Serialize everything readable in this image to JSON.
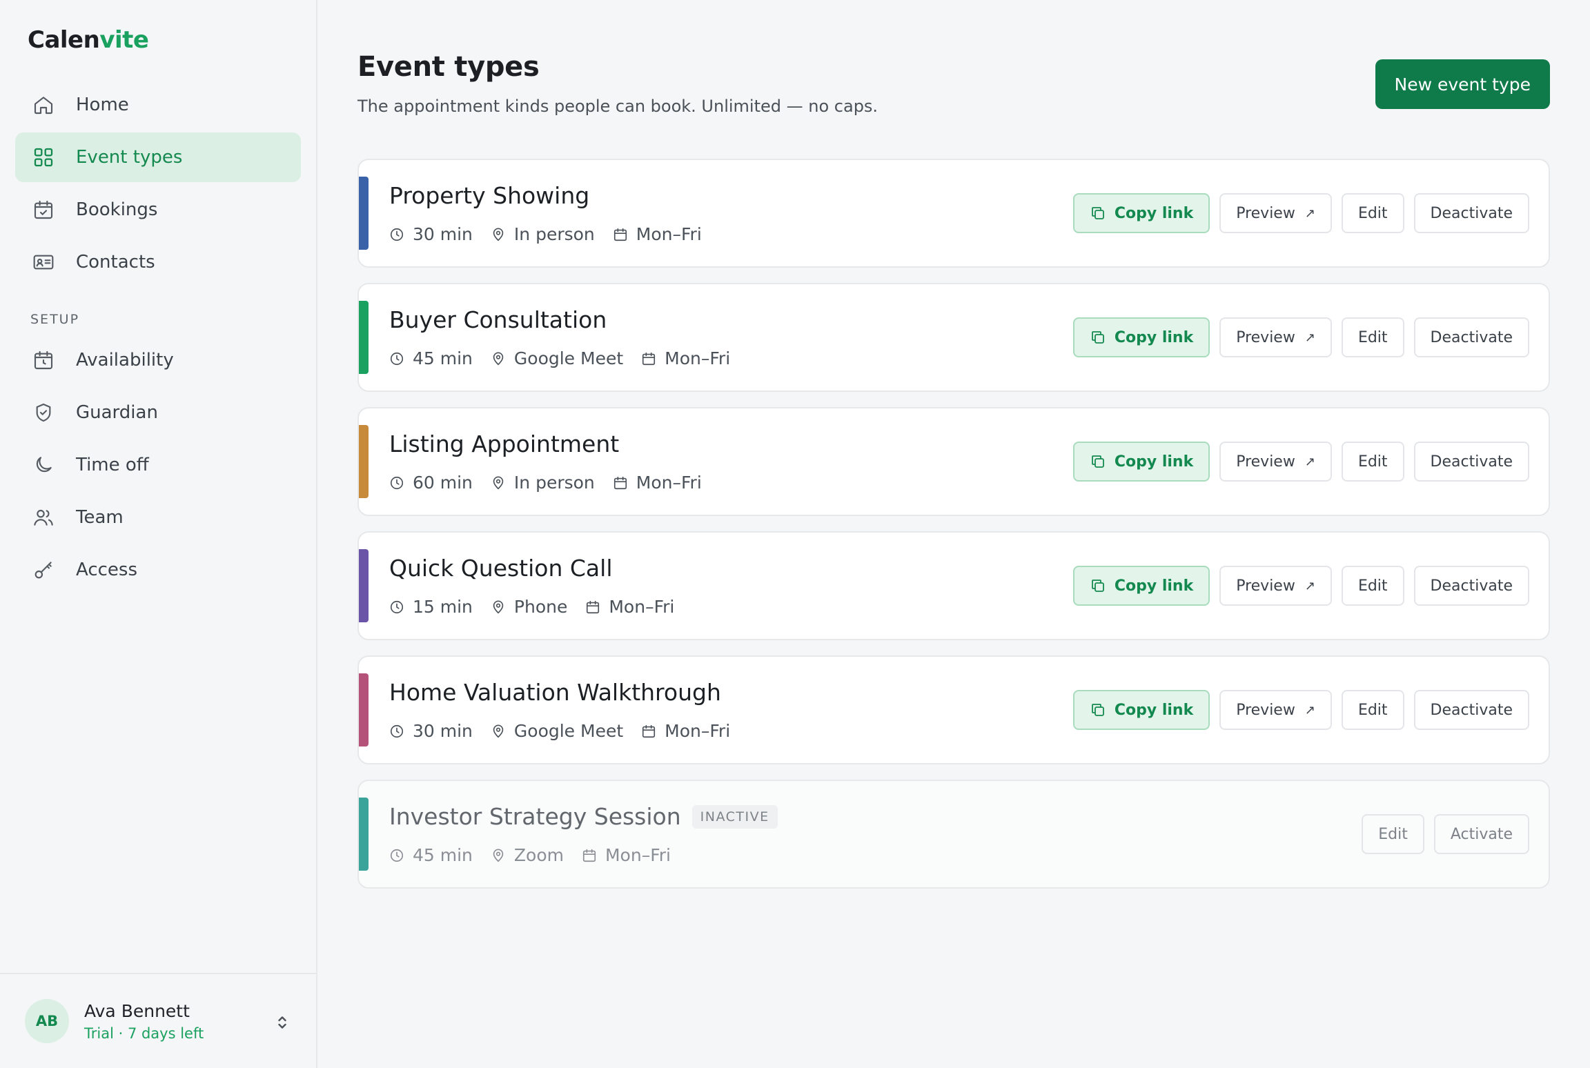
{
  "brand": {
    "logo_part1": "Calen",
    "logo_part2": "vite"
  },
  "sidebar": {
    "items": [
      {
        "label": "Home",
        "icon": "home-icon",
        "active": false
      },
      {
        "label": "Event types",
        "icon": "grid-icon",
        "active": true
      },
      {
        "label": "Bookings",
        "icon": "calendar-check-icon",
        "active": false
      },
      {
        "label": "Contacts",
        "icon": "contact-card-icon",
        "active": false
      }
    ],
    "section_label": "SETUP",
    "setup_items": [
      {
        "label": "Availability",
        "icon": "calendar-clock-icon"
      },
      {
        "label": "Guardian",
        "icon": "shield-check-icon"
      },
      {
        "label": "Time off",
        "icon": "moon-icon"
      },
      {
        "label": "Team",
        "icon": "users-icon"
      },
      {
        "label": "Access",
        "icon": "key-icon"
      }
    ]
  },
  "user": {
    "initials": "AB",
    "name": "Ava Bennett",
    "plan": "Trial · 7 days left"
  },
  "header": {
    "title": "Event types",
    "subtitle": "The appointment kinds people can book. Unlimited — no caps.",
    "new_button": "New event type"
  },
  "labels": {
    "copy": "Copy link",
    "preview": "Preview",
    "edit": "Edit",
    "deactivate": "Deactivate",
    "activate": "Activate",
    "inactive_badge": "INACTIVE"
  },
  "event_types": [
    {
      "title": "Property Showing",
      "duration": "30 min",
      "location": "In person",
      "days": "Mon–Fri",
      "color": "#3a62a8",
      "active": true
    },
    {
      "title": "Buyer Consultation",
      "duration": "45 min",
      "location": "Google Meet",
      "days": "Mon–Fri",
      "color": "#1aa160",
      "active": true
    },
    {
      "title": "Listing Appointment",
      "duration": "60 min",
      "location": "In person",
      "days": "Mon–Fri",
      "color": "#c68a3a",
      "active": true
    },
    {
      "title": "Quick Question Call",
      "duration": "15 min",
      "location": "Phone",
      "days": "Mon–Fri",
      "color": "#6a54a8",
      "active": true
    },
    {
      "title": "Home Valuation Walkthrough",
      "duration": "30 min",
      "location": "Google Meet",
      "days": "Mon–Fri",
      "color": "#b5527a",
      "active": true
    },
    {
      "title": "Investor Strategy Session",
      "duration": "45 min",
      "location": "Zoom",
      "days": "Mon–Fri",
      "color": "#3aa39a",
      "active": false
    }
  ]
}
